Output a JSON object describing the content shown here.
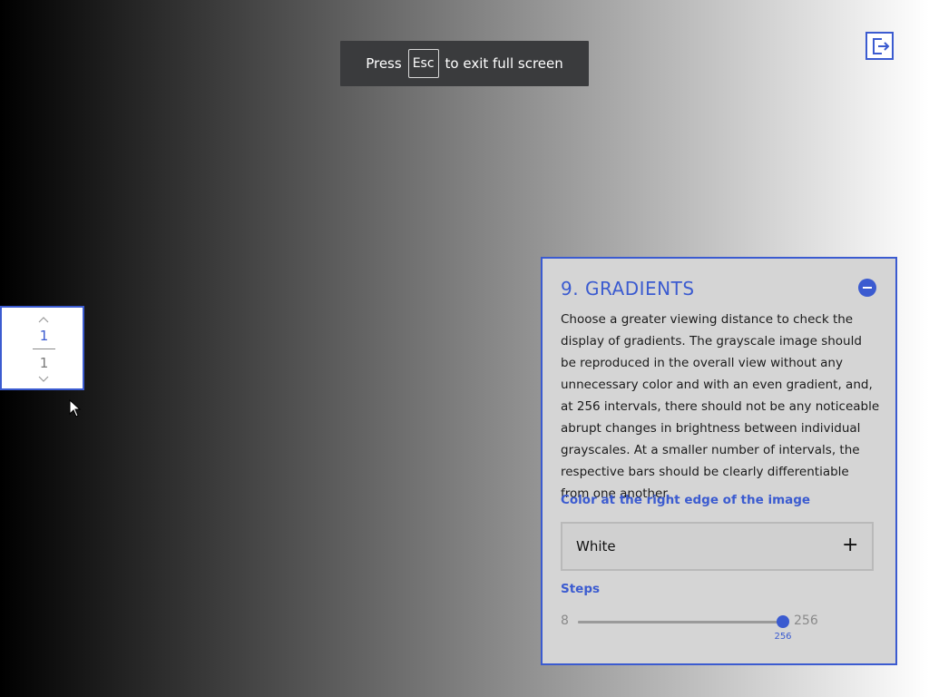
{
  "fullscreen_notice": {
    "prefix": "Press",
    "key": "Esc",
    "suffix": "to exit full screen"
  },
  "exit_button": {
    "icon": "exit-icon"
  },
  "pager": {
    "current": "1",
    "total": "1"
  },
  "panel": {
    "title": "9. GRADIENTS",
    "description": "Choose a greater viewing distance to check the display of gradients. The grayscale image should be reproduced in the overall view without any unnecessary color and with an even gradient, and, at 256 intervals, there should not be any noticeable abrupt changes in brightness between individual grayscales. At a smaller number of intervals, the respective bars should be clearly differentiable from one another.",
    "color_label": "Color at the right edge of the image",
    "color_value": "White",
    "steps_label": "Steps",
    "steps_min": "8",
    "steps_max": "256",
    "steps_value": "256",
    "steps_fraction": 1.0
  },
  "colors": {
    "accent": "#3b5bd0",
    "panel_bg": "#d5d5d5",
    "toast_bg": "#3a3b3d"
  }
}
